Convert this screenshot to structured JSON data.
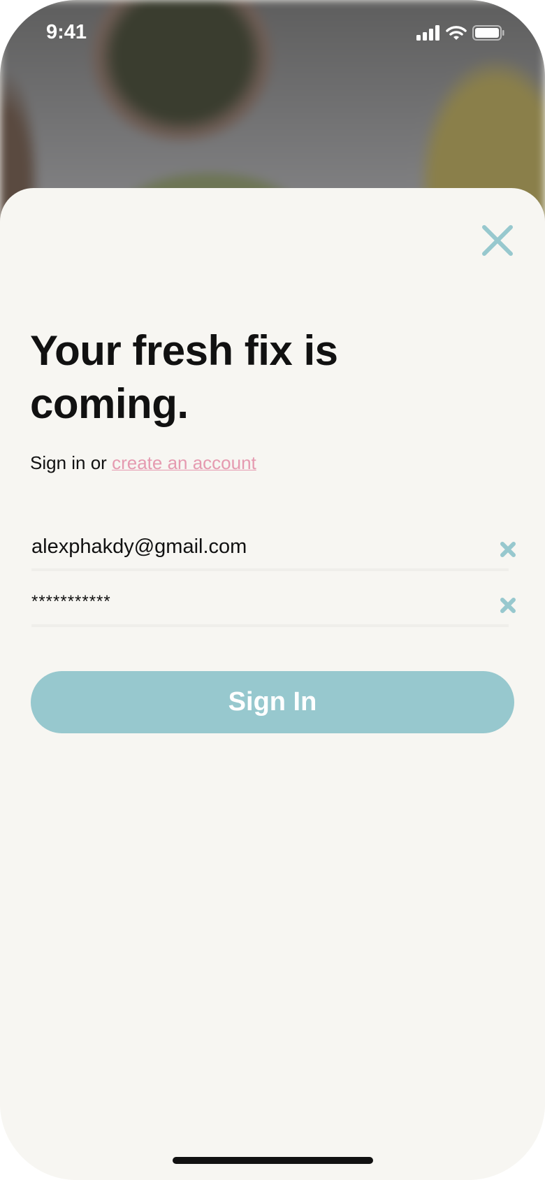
{
  "status_bar": {
    "time": "9:41"
  },
  "heading": "Your fresh fix is coming.",
  "subtitle": {
    "prefix": "Sign in or ",
    "link": "create an account"
  },
  "email": {
    "value": "alexphakdy@gmail.com"
  },
  "password": {
    "value": "***********"
  },
  "sign_in_label": "Sign In",
  "colors": {
    "accent": "#97c8ce",
    "link": "#e59ab0",
    "sheet": "#f7f6f2"
  }
}
